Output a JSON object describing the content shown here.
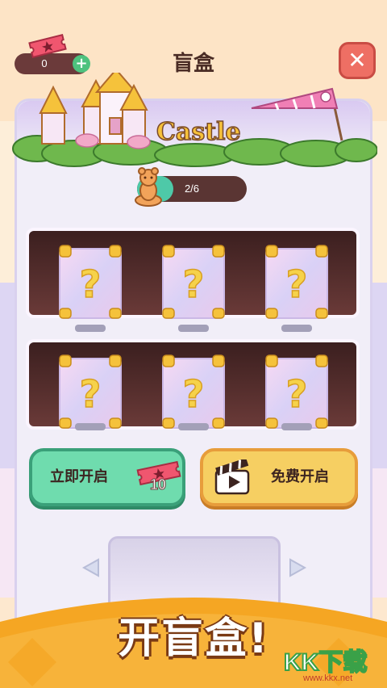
{
  "header": {
    "title": "盲盒",
    "ticket_count": "0",
    "plus_label": "+",
    "close_label": "✕"
  },
  "banner": {
    "theme_title": "Castle"
  },
  "progress": {
    "text": "2/6",
    "fraction": 0.333
  },
  "boxes": [
    {
      "label": "?"
    },
    {
      "label": "?"
    },
    {
      "label": "?"
    },
    {
      "label": "?"
    },
    {
      "label": "?"
    },
    {
      "label": "?"
    }
  ],
  "actions": {
    "open_now_label": "立即开启",
    "open_now_cost": "10",
    "free_open_label": "免费开启"
  },
  "footer": {
    "promo_title": "开盲盒!"
  },
  "watermark": {
    "brand": "KK下载",
    "url": "www.kkx.net"
  },
  "colors": {
    "accent_green": "#6fdcae",
    "accent_yellow": "#f6cf62",
    "close_red": "#ee6f64",
    "banner_orange": "#f5a623"
  }
}
